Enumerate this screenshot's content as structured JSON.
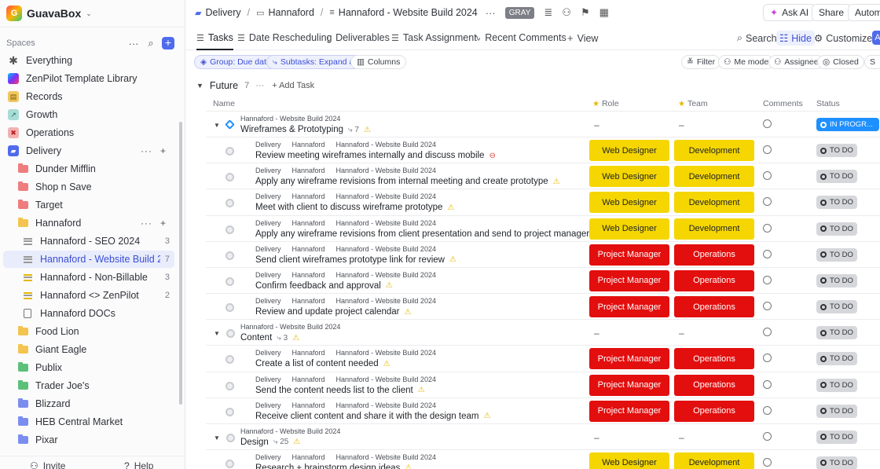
{
  "workspace": {
    "name": "GuavaBox"
  },
  "sidebar": {
    "spaces_label": "Spaces",
    "items": [
      {
        "label": "Everything",
        "icon": "asterisk-icon"
      },
      {
        "label": "ZenPilot Template Library",
        "icon": "zenpilot-logo"
      },
      {
        "label": "Records",
        "icon": "records-icon"
      },
      {
        "label": "Growth",
        "icon": "growth-chart-icon"
      },
      {
        "label": "Operations",
        "icon": "operations-icon"
      },
      {
        "label": "Delivery",
        "icon": "delivery-truck-icon"
      },
      {
        "label": "Dunder Mifflin",
        "icon": "folder-icon"
      },
      {
        "label": "Shop n Save",
        "icon": "folder-icon"
      },
      {
        "label": "Target",
        "icon": "folder-icon"
      },
      {
        "label": "Hannaford",
        "icon": "folder-open-icon"
      },
      {
        "label": "Hannaford - SEO 2024",
        "count": "3",
        "icon": "list-icon"
      },
      {
        "label": "Hannaford - Website Build 2024",
        "count": "7",
        "icon": "list-icon"
      },
      {
        "label": "Hannaford - Non-Billable",
        "count": "3",
        "icon": "list-icon"
      },
      {
        "label": "Hannaford <> ZenPilot",
        "count": "2",
        "icon": "list-icon"
      },
      {
        "label": "Hannaford DOCs",
        "icon": "doc-icon"
      },
      {
        "label": "Food Lion",
        "icon": "folder-icon"
      },
      {
        "label": "Giant Eagle",
        "icon": "folder-icon"
      },
      {
        "label": "Publix",
        "icon": "folder-icon"
      },
      {
        "label": "Trader Joe's",
        "icon": "folder-icon"
      },
      {
        "label": "Blizzard",
        "icon": "folder-icon"
      },
      {
        "label": "HEB Central Market",
        "icon": "folder-icon"
      },
      {
        "label": "Pixar",
        "icon": "folder-icon"
      }
    ],
    "invite": "Invite",
    "help": "Help"
  },
  "colors": {
    "accent": "#4f6bed",
    "role_yellow": "#f5d600",
    "role_red": "#e30e0e",
    "status_progress": "#1e90ff",
    "status_todo": "#d6d7db"
  },
  "topbar": {
    "crumbs": [
      "Delivery",
      "Hannaford",
      "Hannaford - Website Build 2024"
    ],
    "badge": "GRAY",
    "ask_ai": "Ask AI",
    "share": "Share",
    "automate": "Automa"
  },
  "tabs": {
    "items": [
      "Tasks",
      "Date Rescheduling",
      "Deliverables",
      "Task Assignment",
      "Recent Comments"
    ],
    "add_view": "View",
    "search": "Search",
    "hide": "Hide",
    "customize": "Customize",
    "a": "A"
  },
  "filters": {
    "group": "Group: Due date",
    "subtasks": "Subtasks: Expand all",
    "columns": "Columns",
    "filter": "Filter",
    "me_mode": "Me mode",
    "assignee": "Assignee",
    "closed": "Closed",
    "s": "S"
  },
  "group": {
    "title": "Future",
    "count": "7",
    "add_task": "Add Task"
  },
  "columns": {
    "name": "Name",
    "role": "Role",
    "team": "Team",
    "comments": "Comments",
    "status": "Status"
  },
  "rows": [
    {
      "type": "parent",
      "crumbs": [
        "Hannaford - Website Build 2024"
      ],
      "name": "Wireframes & Prototyping",
      "subcount": "7",
      "flag": "warn",
      "role": "–",
      "team": "–",
      "status": "IN PROGR..."
    },
    {
      "type": "child",
      "crumbs": [
        "Delivery",
        "Hannaford",
        "Hannaford - Website Build 2024"
      ],
      "name": "Review meeting wireframes internally and discuss mobile",
      "flag": "stop",
      "role": "Web Designer",
      "team": "Development",
      "status": "TO DO"
    },
    {
      "type": "child",
      "crumbs": [
        "Delivery",
        "Hannaford",
        "Hannaford - Website Build 2024"
      ],
      "name": "Apply any wireframe revisions from internal meeting and create prototype",
      "flag": "warn",
      "role": "Web Designer",
      "team": "Development",
      "status": "TO DO"
    },
    {
      "type": "child",
      "crumbs": [
        "Delivery",
        "Hannaford",
        "Hannaford - Website Build 2024"
      ],
      "name": "Meet with client to discuss wireframe prototype",
      "flag": "warn",
      "role": "Web Designer",
      "team": "Development",
      "status": "TO DO"
    },
    {
      "type": "child",
      "crumbs": [
        "Delivery",
        "Hannaford",
        "Hannaford - Website Build 2024"
      ],
      "name": "Apply any wireframe revisions from client presentation and send to project manager",
      "flag": "warn",
      "role": "Web Designer",
      "team": "Development",
      "status": "TO DO"
    },
    {
      "type": "child",
      "crumbs": [
        "Delivery",
        "Hannaford",
        "Hannaford - Website Build 2024"
      ],
      "name": "Send client wireframes prototype link for review",
      "flag": "warn",
      "role": "Project Manager",
      "team": "Operations",
      "status": "TO DO"
    },
    {
      "type": "child",
      "crumbs": [
        "Delivery",
        "Hannaford",
        "Hannaford - Website Build 2024"
      ],
      "name": "Confirm feedback and approval",
      "flag": "warn",
      "role": "Project Manager",
      "team": "Operations",
      "status": "TO DO"
    },
    {
      "type": "child",
      "crumbs": [
        "Delivery",
        "Hannaford",
        "Hannaford - Website Build 2024"
      ],
      "name": "Review and update project calendar",
      "flag": "warn",
      "role": "Project Manager",
      "team": "Operations",
      "status": "TO DO"
    },
    {
      "type": "parent",
      "crumbs": [
        "Hannaford - Website Build 2024"
      ],
      "name": "Content",
      "subcount": "3",
      "flag": "warn",
      "role": "–",
      "team": "–",
      "status": "TO DO"
    },
    {
      "type": "child",
      "crumbs": [
        "Delivery",
        "Hannaford",
        "Hannaford - Website Build 2024"
      ],
      "name": "Create a list of content needed",
      "flag": "warn",
      "role": "Project Manager",
      "team": "Operations",
      "status": "TO DO"
    },
    {
      "type": "child",
      "crumbs": [
        "Delivery",
        "Hannaford",
        "Hannaford - Website Build 2024"
      ],
      "name": "Send the content needs list to the client",
      "flag": "warn",
      "role": "Project Manager",
      "team": "Operations",
      "status": "TO DO"
    },
    {
      "type": "child",
      "crumbs": [
        "Delivery",
        "Hannaford",
        "Hannaford - Website Build 2024"
      ],
      "name": "Receive client content and share it with the design team",
      "flag": "warn",
      "role": "Project Manager",
      "team": "Operations",
      "status": "TO DO"
    },
    {
      "type": "parent",
      "crumbs": [
        "Hannaford - Website Build 2024"
      ],
      "name": "Design",
      "subcount": "25",
      "flag": "warn",
      "role": "–",
      "team": "–",
      "status": "TO DO"
    },
    {
      "type": "child",
      "crumbs": [
        "Delivery",
        "Hannaford",
        "Hannaford - Website Build 2024"
      ],
      "name": "Research + brainstorm design ideas",
      "flag": "warn",
      "role": "Web Designer",
      "team": "Development",
      "status": "TO DO"
    }
  ]
}
